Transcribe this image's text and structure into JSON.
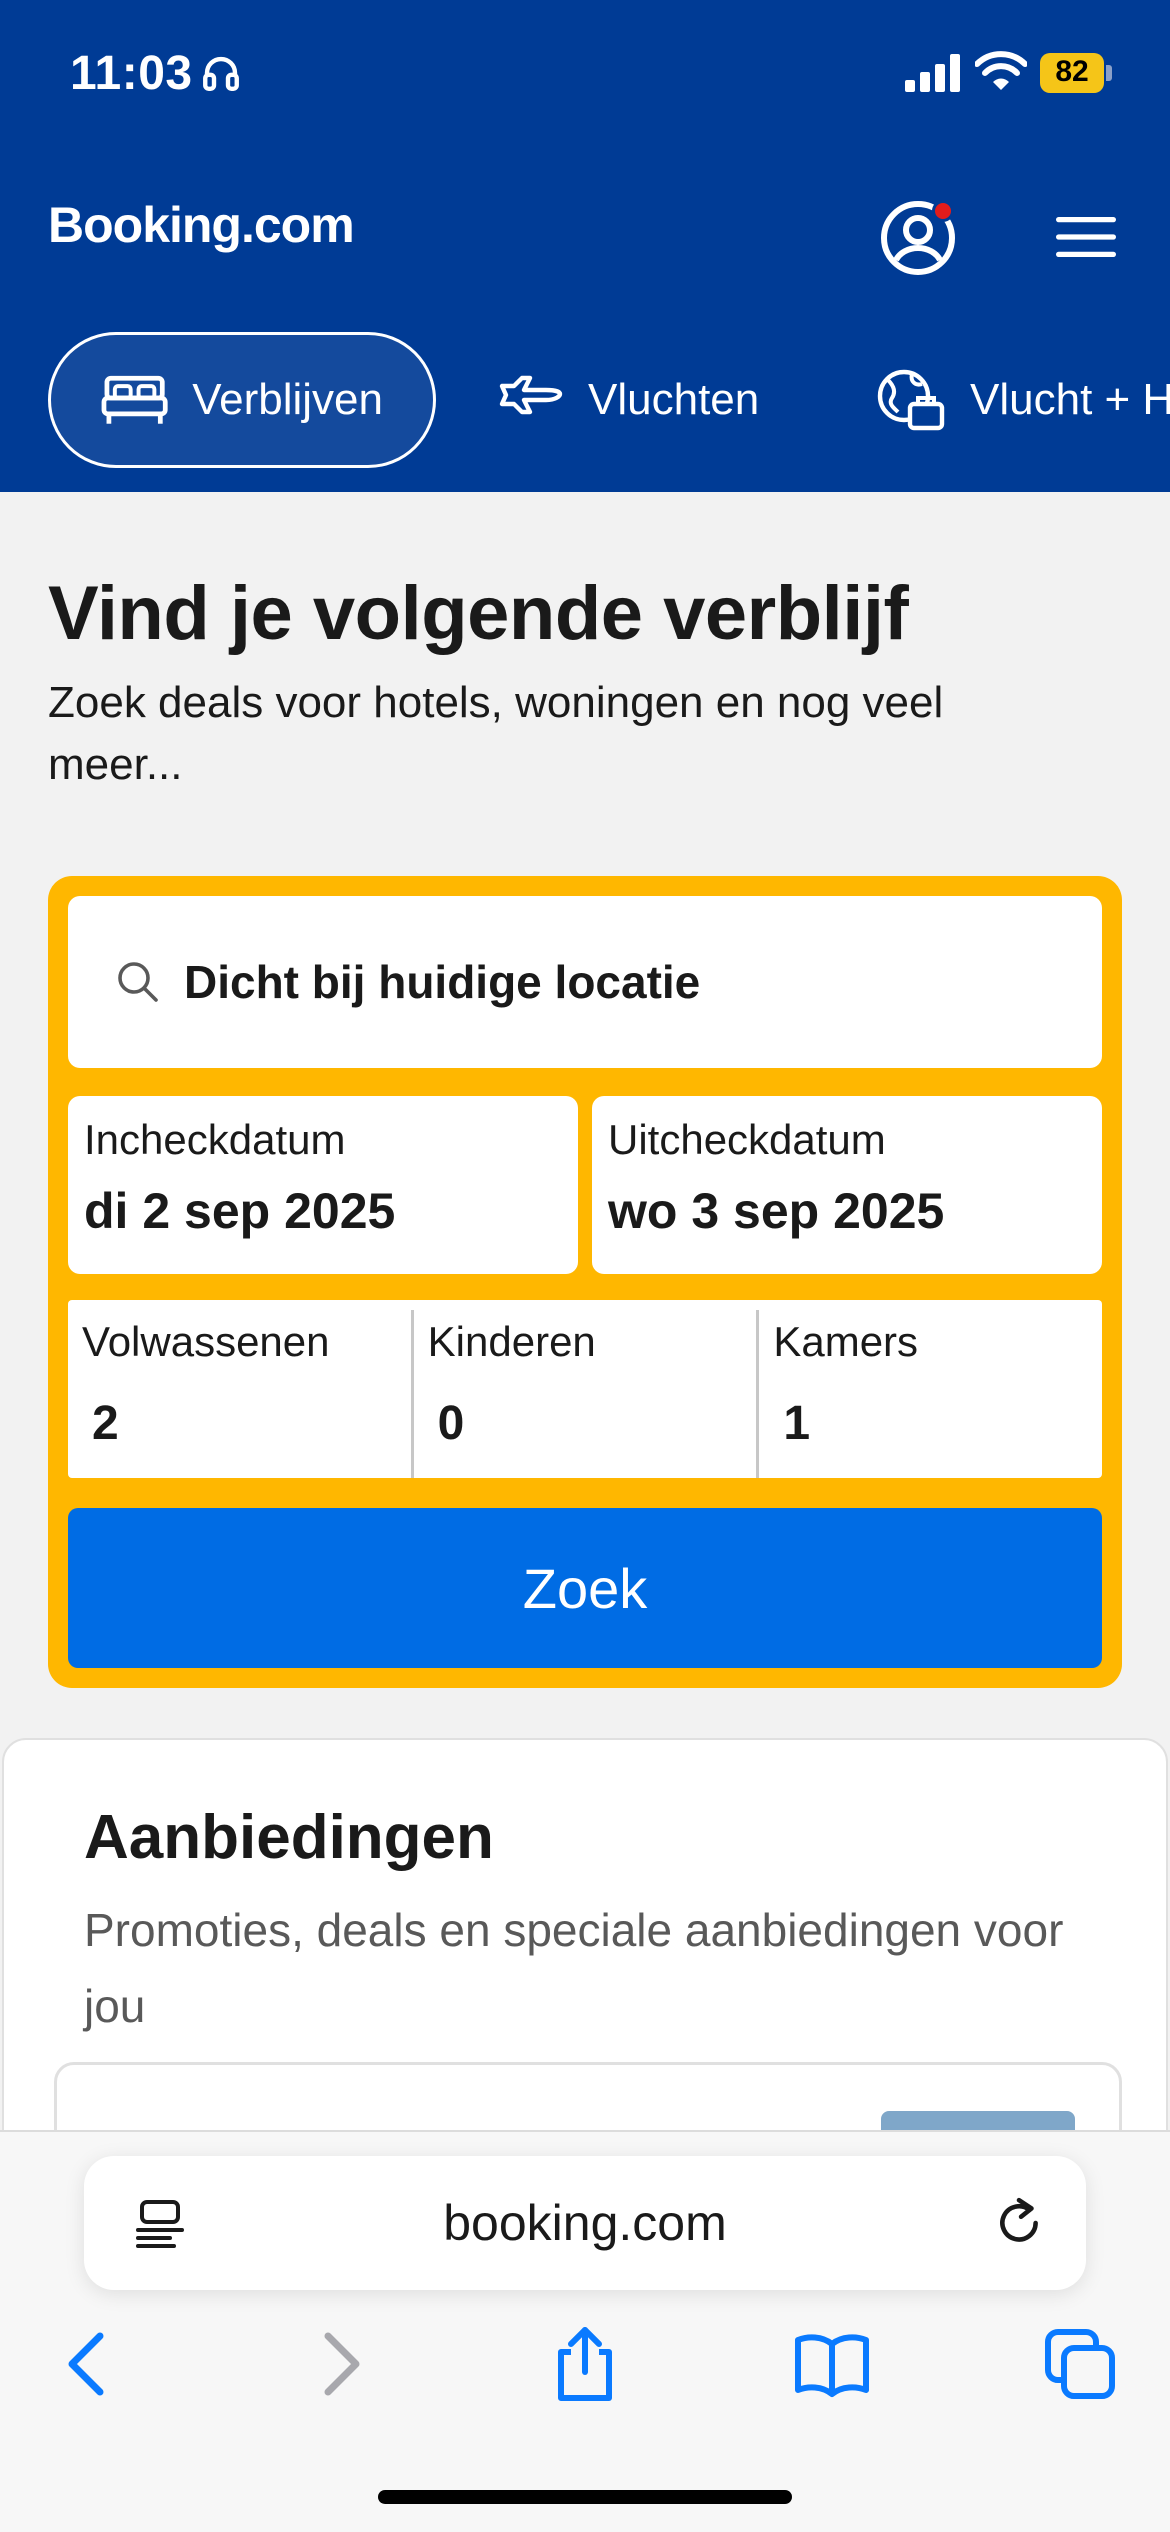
{
  "status_bar": {
    "time": "11:03",
    "battery": "82"
  },
  "header": {
    "logo": "Booking.com",
    "tabs": [
      {
        "label": "Verblijven",
        "active": true
      },
      {
        "label": "Vluchten",
        "active": false
      },
      {
        "label": "Vlucht + H",
        "active": false
      }
    ]
  },
  "hero": {
    "title": "Vind je volgende verblijf",
    "subtitle": "Zoek deals voor hotels, woningen en nog veel meer..."
  },
  "search": {
    "destination": "Dicht bij huidige locatie",
    "checkin_label": "Incheckdatum",
    "checkin_value": "di 2 sep 2025",
    "checkout_label": "Uitcheckdatum",
    "checkout_value": "wo 3 sep 2025",
    "adults_label": "Volwassenen",
    "adults_value": "2",
    "children_label": "Kinderen",
    "children_value": "0",
    "rooms_label": "Kamers",
    "rooms_value": "1",
    "button_label": "Zoek"
  },
  "offers": {
    "title": "Aanbiedingen",
    "subtitle": "Promoties, deals en speciale aanbiedingen voor jou"
  },
  "browser": {
    "url": "booking.com"
  },
  "colors": {
    "brand_blue": "#003b95",
    "accent_yellow": "#ffb700",
    "button_blue": "#006ce4",
    "notification_red": "#e21c1c"
  }
}
